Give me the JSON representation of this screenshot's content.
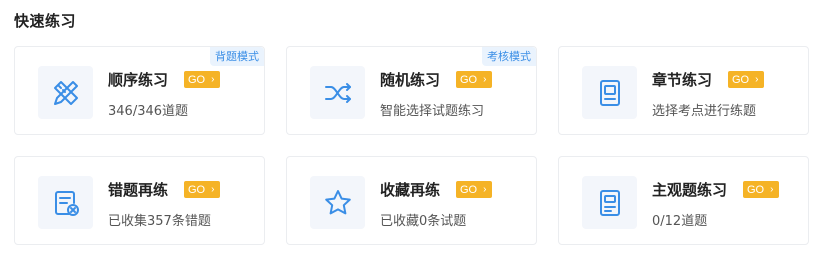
{
  "section": {
    "title": "快速练习"
  },
  "cards": [
    {
      "title": "顺序练习",
      "go": "GO",
      "sub": "346/346道题",
      "tag": "背题模式",
      "icon": "pencil-ruler-icon"
    },
    {
      "title": "随机练习",
      "go": "GO",
      "sub": "智能选择试题练习",
      "tag": "考核模式",
      "icon": "shuffle-icon"
    },
    {
      "title": "章节练习",
      "go": "GO",
      "sub": "选择考点进行练题",
      "icon": "chapter-book-icon"
    },
    {
      "title": "错题再练",
      "go": "GO",
      "sub": "已收集357条错题",
      "icon": "wrong-doc-icon"
    },
    {
      "title": "收藏再练",
      "go": "GO",
      "sub": "已收藏0条试题",
      "icon": "star-icon"
    },
    {
      "title": "主观题练习",
      "go": "GO",
      "sub": "0/12道题",
      "icon": "subjective-doc-icon"
    }
  ],
  "colors": {
    "accent": "#3a8ee6",
    "go_badge": "#f5b326",
    "tag_bg": "#eaf3fd"
  }
}
